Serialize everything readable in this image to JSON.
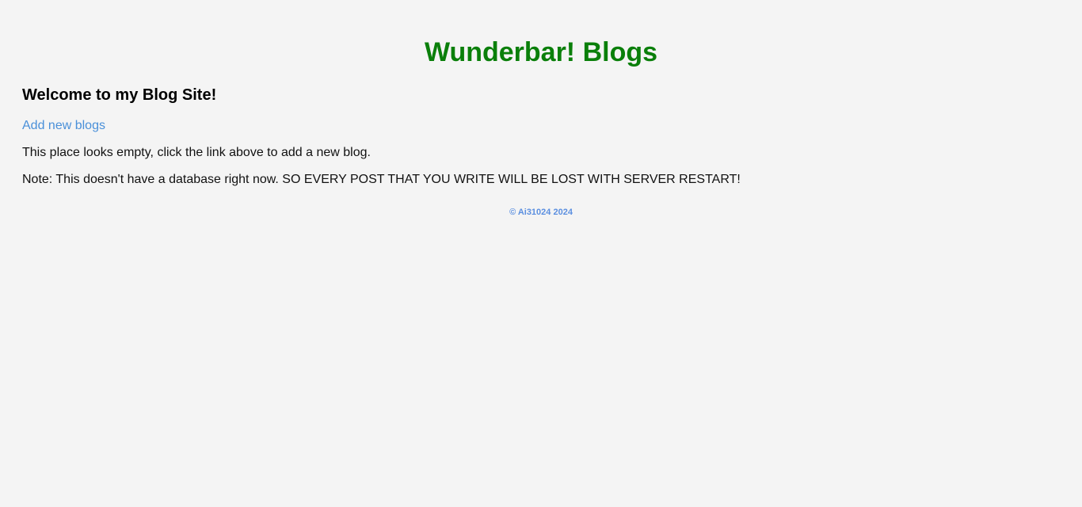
{
  "header": {
    "title": "Wunderbar! Blogs"
  },
  "main": {
    "welcome": "Welcome to my Blog Site!",
    "add_link_label": "Add new blogs",
    "empty_message": "This place looks empty, click the link above to add a new blog.",
    "note": "Note: This doesn't have a database right now. SO EVERY POST THAT YOU WRITE WILL BE LOST WITH SERVER RESTART!"
  },
  "footer": {
    "copyright": "© Ai31024 2024"
  },
  "colors": {
    "title": "#0a7f0a",
    "link": "#4a90d9",
    "footer": "#5b8fe0",
    "background": "#f4f4f4"
  }
}
